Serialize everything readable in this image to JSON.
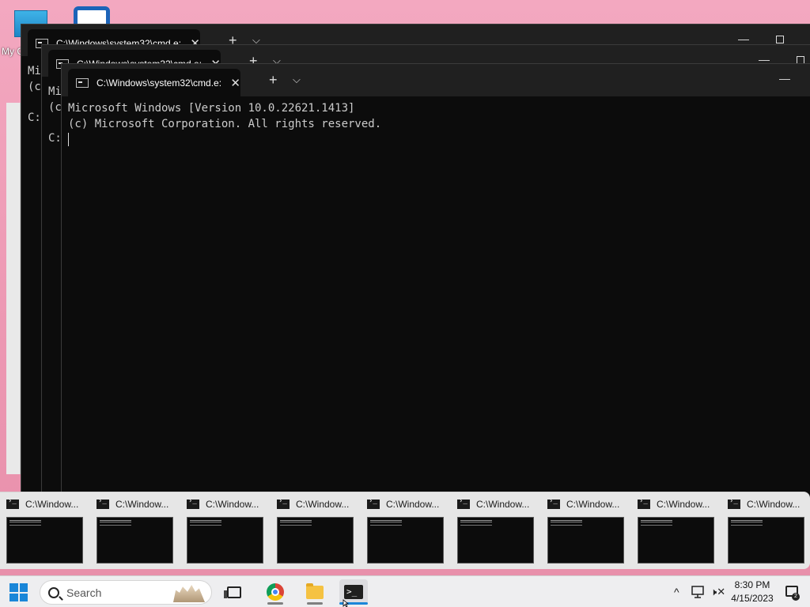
{
  "desktop": {
    "icon_label": "My C"
  },
  "windows": [
    {
      "tab_title": "C:\\Windows\\system32\\cmd.e:",
      "close_glyph": "✕",
      "plus_glyph": "+",
      "chevron_glyph": "⌵",
      "min_glyph": "—",
      "body": "Mi\n(c\n\nC:"
    },
    {
      "tab_title": "C:\\Windows\\system32\\cmd.e:",
      "close_glyph": "✕",
      "plus_glyph": "+",
      "chevron_glyph": "⌵",
      "min_glyph": "—",
      "body": "Mi\n(c\n\nC:"
    },
    {
      "tab_title": "C:\\Windows\\system32\\cmd.e:",
      "close_glyph": "✕",
      "plus_glyph": "+",
      "chevron_glyph": "⌵",
      "min_glyph": "—",
      "body": "Microsoft Windows [Version 10.0.22621.1413]\n(c) Microsoft Corporation. All rights reserved.\n"
    }
  ],
  "previews": [
    {
      "title": "C:\\Window..."
    },
    {
      "title": "C:\\Window..."
    },
    {
      "title": "C:\\Window..."
    },
    {
      "title": "C:\\Window..."
    },
    {
      "title": "C:\\Window..."
    },
    {
      "title": "C:\\Window..."
    },
    {
      "title": "C:\\Window..."
    },
    {
      "title": "C:\\Window..."
    },
    {
      "title": "C:\\Window..."
    }
  ],
  "taskbar": {
    "search_placeholder": "Search",
    "tray_chevron": "^",
    "clock_time": "8:30 PM",
    "clock_date": "4/15/2023",
    "notification_count": "2",
    "volume_glyph": "🕨✕"
  },
  "colors": {
    "accent": "#1a86d8",
    "terminal_bg": "#0c0c0c",
    "titlebar_bg": "#202020",
    "desktop_bg": "#ef9fb8"
  },
  "icons": [
    "windows-start-icon",
    "search-icon",
    "task-view-icon",
    "chrome-icon",
    "file-explorer-icon",
    "terminal-icon",
    "network-icon",
    "volume-muted-icon",
    "notification-icon"
  ]
}
